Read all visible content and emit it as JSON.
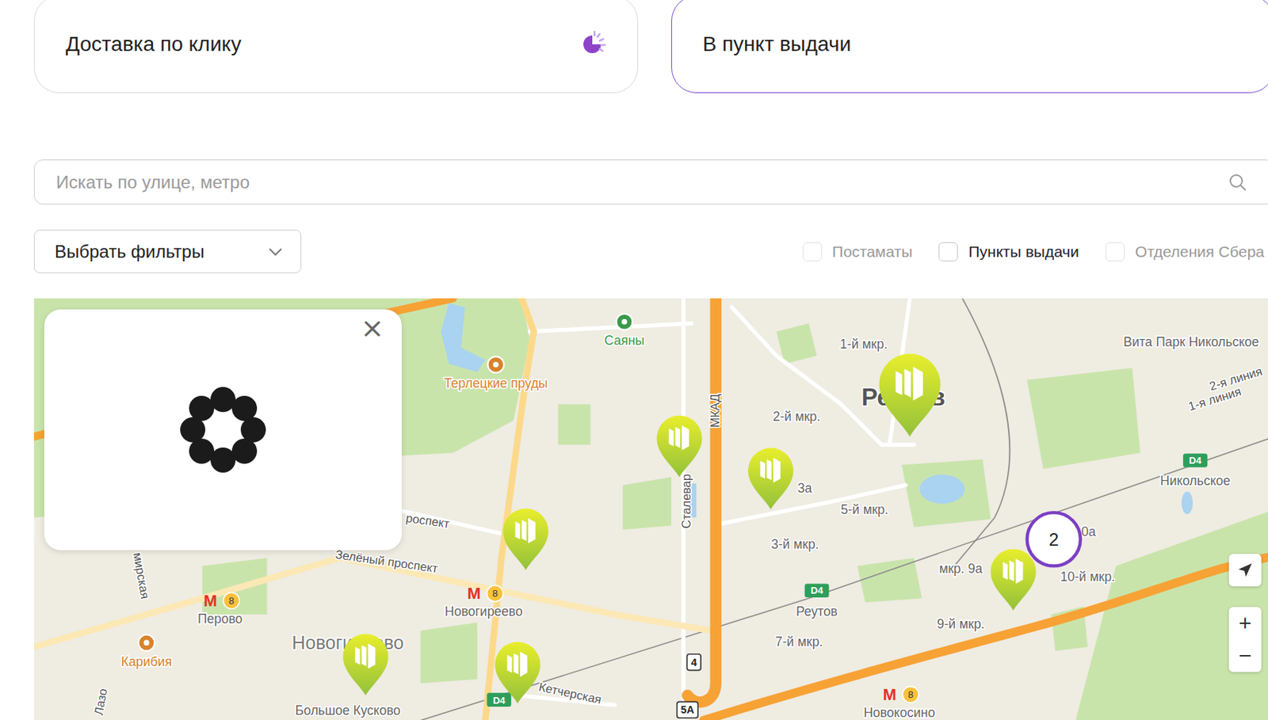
{
  "delivery_options": [
    {
      "label": "Доставка по клику",
      "selected": false
    },
    {
      "label": "В пункт выдачи",
      "selected": true
    }
  ],
  "search": {
    "placeholder": "Искать по улице, метро"
  },
  "filters": {
    "label": "Выбрать фильтры"
  },
  "checkboxes": [
    {
      "label": "Постаматы",
      "checked": false,
      "disabled": true
    },
    {
      "label": "Пункты выдачи",
      "checked": false,
      "disabled": false
    },
    {
      "label": "Отделения Сбера",
      "checked": false,
      "disabled": true
    }
  ],
  "map": {
    "labels": [
      {
        "text": "Саяны",
        "kind": "poi",
        "color": "#3a9a4a"
      },
      {
        "text": "Терлецкие пруды",
        "kind": "poi",
        "color": "#d9822b"
      },
      {
        "text": "1-й мкр.",
        "kind": "place"
      },
      {
        "text": "Реутов",
        "kind": "city"
      },
      {
        "text": "Вита Парк Никольское",
        "kind": "place"
      },
      {
        "text": "2-я линия",
        "kind": "street"
      },
      {
        "text": "1-я линия",
        "kind": "street"
      },
      {
        "text": "2-й мкр.",
        "kind": "place"
      },
      {
        "text": "3а",
        "kind": "place"
      },
      {
        "text": "5-й мкр.",
        "kind": "place"
      },
      {
        "text": "3-й мкр.",
        "kind": "place"
      },
      {
        "text": "0а",
        "kind": "place"
      },
      {
        "text": "мкр. 9а",
        "kind": "place"
      },
      {
        "text": "10-й мкр.",
        "kind": "place"
      },
      {
        "text": "9-й мкр.",
        "kind": "place"
      },
      {
        "text": "7-й мкр.",
        "kind": "place"
      },
      {
        "text": "Реутов",
        "kind": "rail-station",
        "badge": "D4"
      },
      {
        "text": "Никольское",
        "kind": "rail-station",
        "badge": "D4"
      },
      {
        "text": "Перово",
        "kind": "metro",
        "logo": "M",
        "line": "8"
      },
      {
        "text": "Новогиреево",
        "kind": "metro",
        "logo": "M",
        "line": "8"
      },
      {
        "text": "Новогиреево",
        "kind": "district"
      },
      {
        "text": "Карибия",
        "kind": "poi",
        "color": "#d9822b"
      },
      {
        "text": "Большое Кусково",
        "kind": "place"
      },
      {
        "text": "Новокосино",
        "kind": "metro",
        "logo": "M",
        "line": "8"
      },
      {
        "text": "Кетчерская",
        "kind": "street"
      },
      {
        "text": "Зелёный проспект",
        "kind": "street"
      },
      {
        "text": "роспект",
        "kind": "street"
      },
      {
        "text": "Сталевар",
        "kind": "street"
      },
      {
        "text": "МКАД",
        "kind": "street"
      },
      {
        "text": "Лазо",
        "kind": "street"
      },
      {
        "text": "мирская",
        "kind": "street"
      },
      {
        "text": "4",
        "kind": "shield"
      },
      {
        "text": "5А",
        "kind": "shield"
      },
      {
        "text": "D4",
        "kind": "rail-badge"
      }
    ],
    "pins": [
      {
        "kind": "small"
      },
      {
        "kind": "small"
      },
      {
        "kind": "small"
      },
      {
        "kind": "large"
      },
      {
        "kind": "small"
      },
      {
        "kind": "small"
      },
      {
        "kind": "small"
      }
    ],
    "cluster": {
      "count": "2"
    },
    "zoom": [
      "+",
      "−"
    ]
  },
  "popup": {
    "close": "×",
    "loading": true
  }
}
